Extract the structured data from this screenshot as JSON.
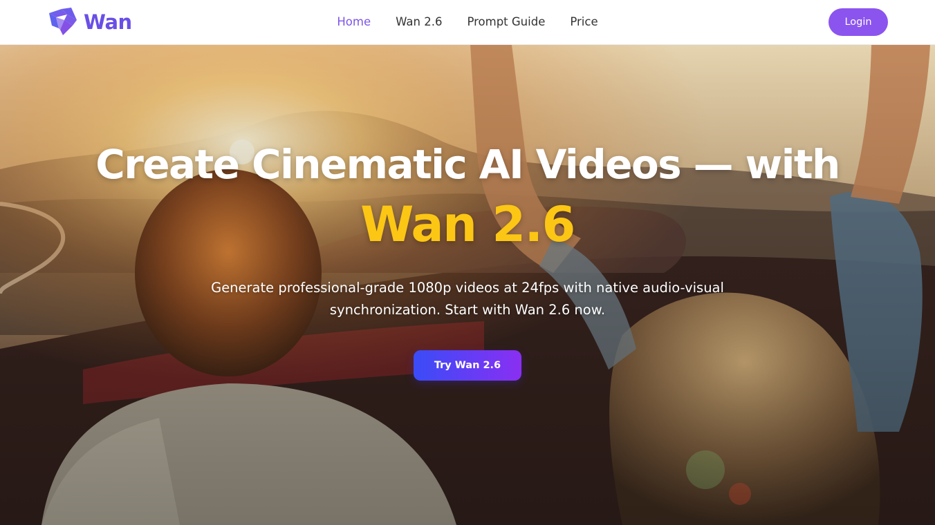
{
  "brand": {
    "name": "Wan",
    "logo_icon": "wan-logo-icon",
    "color": "#6a4fe6"
  },
  "nav": {
    "items": [
      {
        "label": "Home",
        "active": true
      },
      {
        "label": "Wan 2.6",
        "active": false
      },
      {
        "label": "Prompt Guide",
        "active": false
      },
      {
        "label": "Price",
        "active": false
      }
    ],
    "active_color": "#7c55e6",
    "login_label": "Login",
    "login_color": "#8b54ee"
  },
  "hero": {
    "background": "photo-couple-in-convertible-at-sunset",
    "title": "Create Cinematic AI Videos — with",
    "title_accent": "Wan 2.6",
    "accent_color": "#fcc614",
    "subtitle": "Generate professional-grade 1080p videos at 24fps with native audio-visual synchronization. Start with Wan 2.6 now.",
    "cta_label": "Try Wan 2.6",
    "cta_gradient": [
      "#3a4cf7",
      "#8a2ff2"
    ]
  }
}
